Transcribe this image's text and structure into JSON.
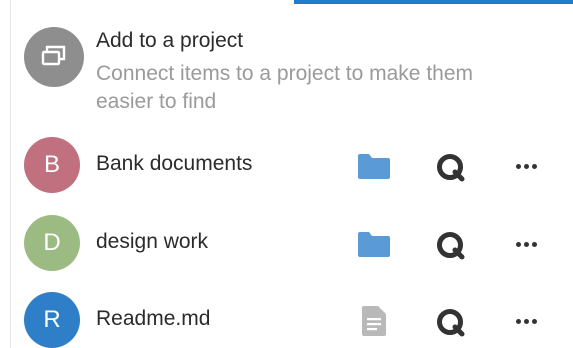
{
  "add_project": {
    "title": "Add to a project",
    "description": "Connect items to a project to make them easier to find",
    "icon": "project-stack-icon",
    "avatar_color": "#8e8e8e"
  },
  "items": [
    {
      "initial": "B",
      "name": "Bank documents",
      "avatar_color": "#c0707e",
      "type_icon": "folder-icon",
      "type_color": "#5b9bd5"
    },
    {
      "initial": "D",
      "name": "design work",
      "avatar_color": "#9cbb82",
      "type_icon": "folder-icon",
      "type_color": "#5b9bd5"
    },
    {
      "initial": "R",
      "name": "Readme.md",
      "avatar_color": "#2f7fc8",
      "type_icon": "document-icon",
      "type_color": "#b9b9b9"
    }
  ],
  "colors": {
    "accent": "#1f7ecb",
    "text": "#2b2b2b",
    "muted_text": "#9a9a9a",
    "icon_dark": "#333333"
  }
}
